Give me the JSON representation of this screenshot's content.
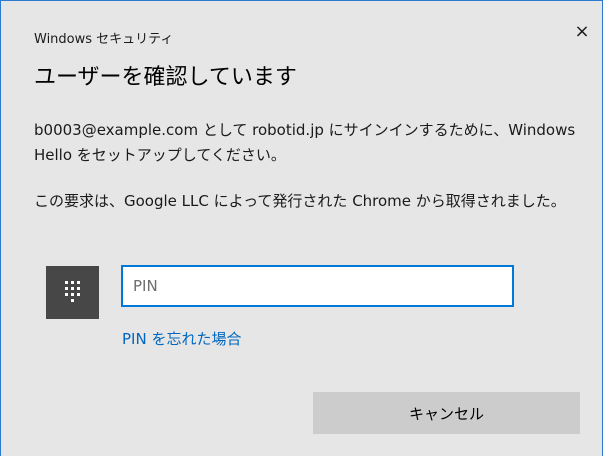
{
  "window": {
    "title": "Windows セキュリティ",
    "close_label": "×"
  },
  "heading": "ユーザーを確認しています",
  "messages": [
    "b0003@example.com として robotid.jp にサインインするために、Windows Hello をセットアップしてください。",
    "この要求は、Google LLC によって発行された Chrome から取得されました。"
  ],
  "pin": {
    "icon": "keypad-icon",
    "value": "",
    "placeholder": "PIN"
  },
  "forgot_pin_label": "PIN を忘れた場合",
  "cancel_label": "キャンセル",
  "colors": {
    "accent": "#0078d7",
    "link": "#0067c0",
    "dialog_background": "#e6e6e6",
    "pin_tile": "#474747",
    "button": "#cccccc"
  }
}
